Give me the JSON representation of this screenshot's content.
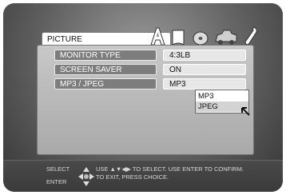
{
  "menu": {
    "tab_title": "PICTURE",
    "icons": [
      "speaker-a-icon",
      "document-icon",
      "disc-icon",
      "car-icon",
      "wrench-icon"
    ],
    "rows": [
      {
        "label": "MONITOR TYPE",
        "value": "4:3LB"
      },
      {
        "label": "SCREEN SAVER",
        "value": "ON"
      },
      {
        "label": "MP3 / JPEG",
        "value": "MP3"
      }
    ],
    "dropdown": {
      "options": [
        "MP3",
        "JPEG"
      ],
      "highlighted": "JPEG"
    }
  },
  "footer": {
    "select_label": "SELECT",
    "enter_label": "ENTER",
    "line1": "USE ▲▼◀▶ TO SELECT.  USE ENTER TO CONFIRM.",
    "line2": "TO EXIT, PRESS CHOICE."
  }
}
